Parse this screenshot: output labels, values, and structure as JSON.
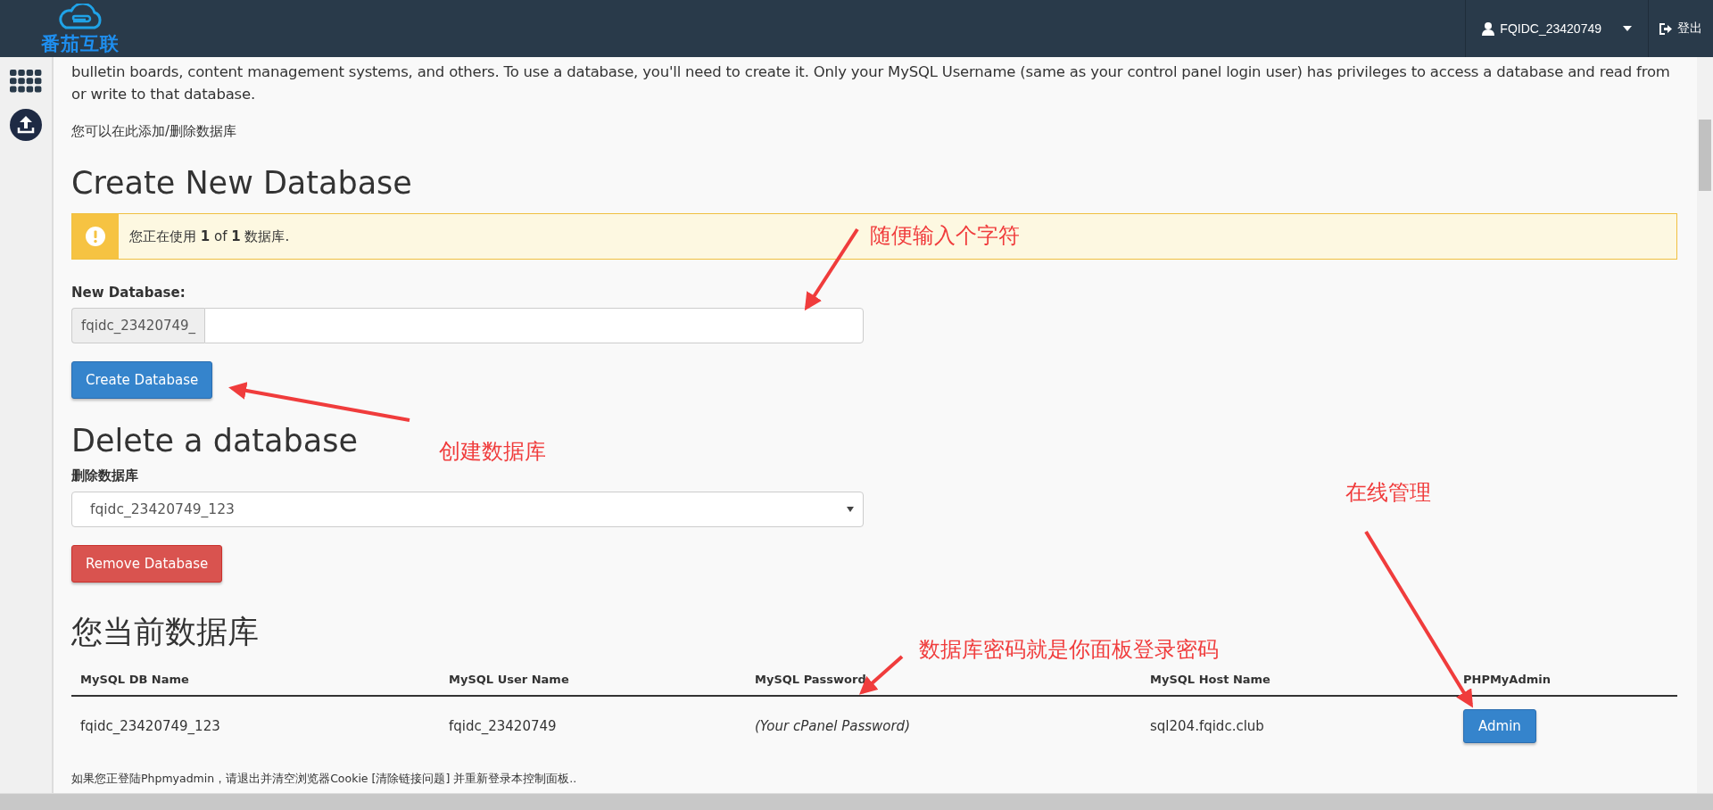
{
  "header": {
    "logo_text": "番茄互联",
    "user": "FQIDC_23420749",
    "logout": "登出"
  },
  "sidebar": {
    "items": [
      {
        "kind": "apps"
      },
      {
        "kind": "upload"
      }
    ]
  },
  "intro": {
    "text": "bulletin boards, content management systems, and others. To use a database, you'll need to create it. Only your MySQL Username (same as your control panel login user) has privileges to access a database and read from or write to that database.",
    "note": "您可以在此添加/删除数据库"
  },
  "create": {
    "title": "Create New Database",
    "alert": "您正在使用 **1** of **1** 数据库.",
    "label": "New Database:",
    "prefix": "fqidc_23420749_",
    "button": "Create Database"
  },
  "delete": {
    "title": "Delete a database",
    "label": "删除数据库",
    "selected_value": "fqidc_23420749_123",
    "button": "Remove Database"
  },
  "current": {
    "title": "您当前数据库",
    "table": {
      "columns": [
        "MySQL DB Name",
        "MySQL User Name",
        "MySQL Password",
        "MySQL Host Name",
        "PHPMyAdmin"
      ],
      "rows": [
        {
          "db": "fqidc_23420749_123",
          "user": "fqidc_23420749",
          "password": "(Your cPanel Password)",
          "host": "sql204.fqidc.club",
          "action": "Admin"
        }
      ]
    }
  },
  "footer_note": "如果您正登陆Phpmyadmin，请退出并清空浏览器Cookie [清除链接问题] 并重新登录本控制面板..",
  "annotations": [
    {
      "text": "随便输入个字符",
      "kind": "down-left"
    },
    {
      "text": "创建数据库",
      "kind": "left"
    },
    {
      "text": "在线管理",
      "kind": "down-right"
    },
    {
      "text": "数据库密码就是你面板登录密码",
      "kind": "down-left-short"
    }
  ]
}
